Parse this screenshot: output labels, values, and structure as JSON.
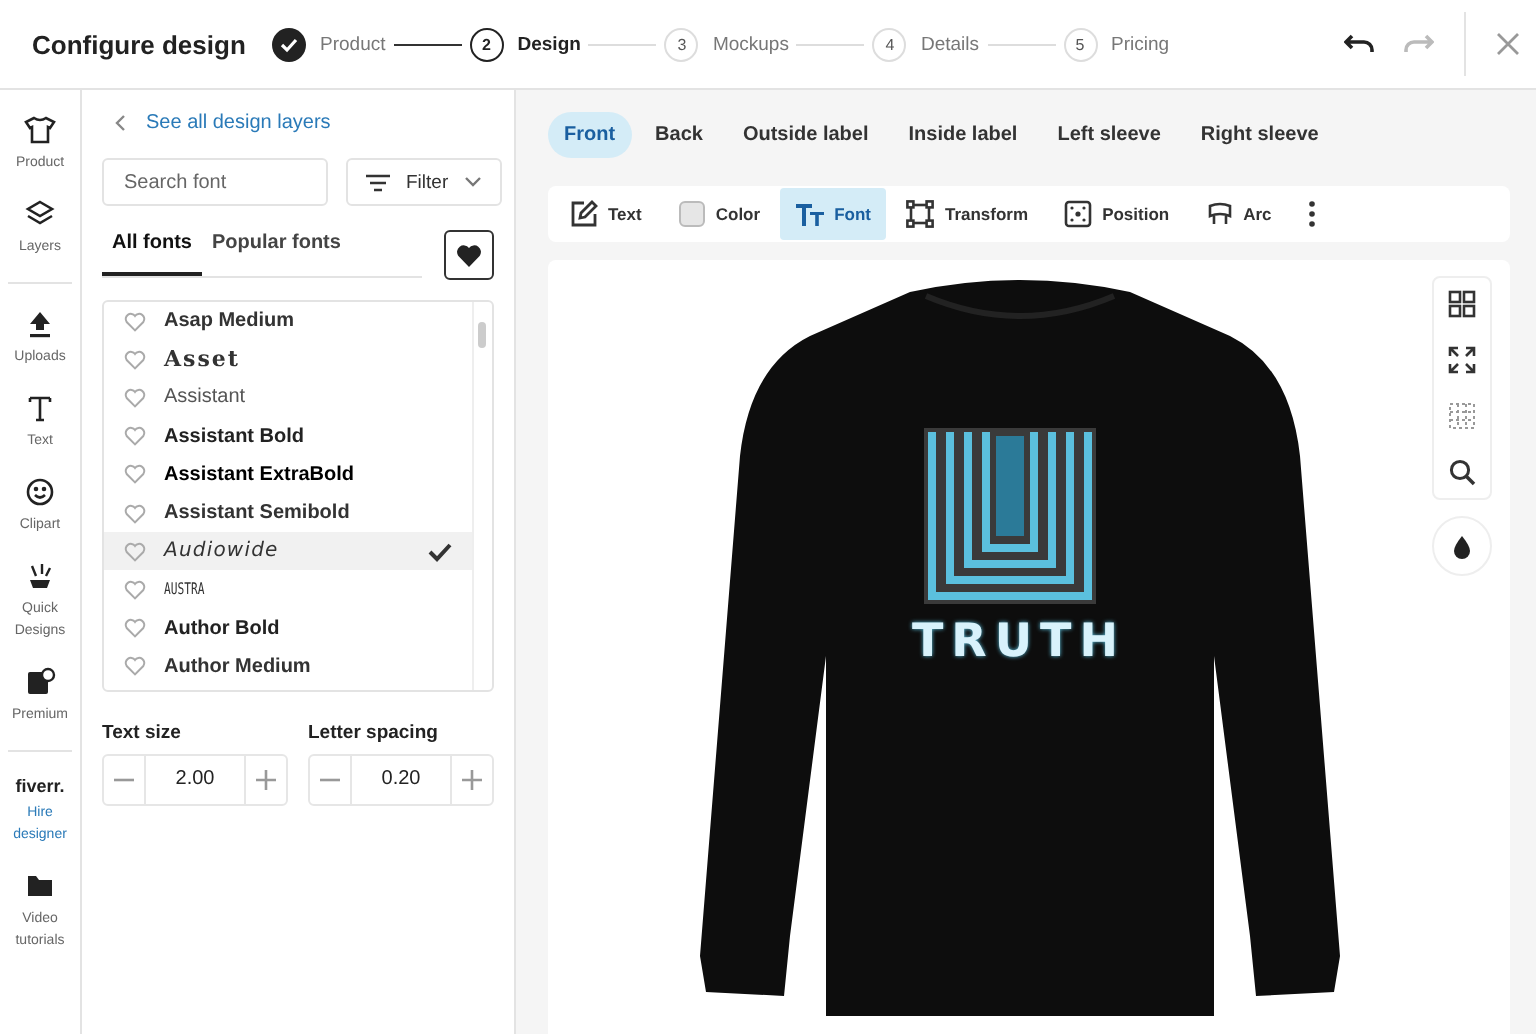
{
  "header": {
    "title": "Configure design",
    "steps": [
      {
        "label": "Product",
        "completed": true,
        "selected": false
      },
      {
        "number": "2",
        "label": "Design",
        "completed": false,
        "selected": true
      },
      {
        "number": "3",
        "label": "Mockups",
        "completed": false,
        "selected": false
      },
      {
        "number": "4",
        "label": "Details",
        "completed": false,
        "selected": false
      },
      {
        "number": "5",
        "label": "Pricing",
        "completed": false,
        "selected": false
      }
    ]
  },
  "rail": [
    {
      "kind": "tool",
      "label": "Product"
    },
    {
      "kind": "tool",
      "label": "Layers"
    },
    {
      "kind": "divider"
    },
    {
      "kind": "tool",
      "label": "Uploads"
    },
    {
      "kind": "tool",
      "label": "Text"
    },
    {
      "kind": "tool",
      "label": "Clipart"
    },
    {
      "kind": "tool",
      "label": "Quick Designs"
    },
    {
      "kind": "tool",
      "label": "Premium"
    },
    {
      "kind": "divider"
    },
    {
      "kind": "brand",
      "brand": "fiverr.",
      "label": "Hire designer"
    },
    {
      "kind": "tool",
      "label": "Video tutorials"
    }
  ],
  "panel": {
    "back_link": "See all design layers",
    "search": {
      "placeholder": "Search font"
    },
    "filter": "Filter",
    "tabs": [
      {
        "label": "All fonts",
        "selected": true
      },
      {
        "label": "Popular fonts",
        "selected": false
      }
    ],
    "fonts": [
      {
        "name": "Asap Medium",
        "kind": "medium",
        "selected": false
      },
      {
        "name": "Asset",
        "kind": "display",
        "selected": false
      },
      {
        "name": "Assistant",
        "kind": "light",
        "selected": false
      },
      {
        "name": "Assistant Bold",
        "kind": "bold",
        "selected": false
      },
      {
        "name": "Assistant ExtraBold",
        "kind": "extrabold",
        "selected": false
      },
      {
        "name": "Assistant Semibold",
        "kind": "medium",
        "selected": false
      },
      {
        "name": "Audiowide",
        "kind": "wide",
        "selected": true
      },
      {
        "name": "AUSTRA",
        "kind": "condensed",
        "selected": false
      },
      {
        "name": "Author Bold",
        "kind": "bold",
        "selected": false
      },
      {
        "name": "Author Medium",
        "kind": "medium",
        "selected": false
      }
    ],
    "text_size": {
      "label": "Text size",
      "value": "2.00"
    },
    "letter_spacing": {
      "label": "Letter spacing",
      "value": "0.20"
    }
  },
  "views": [
    {
      "label": "Front",
      "selected": true
    },
    {
      "label": "Back",
      "selected": false
    },
    {
      "label": "Outside label",
      "selected": false
    },
    {
      "label": "Inside label",
      "selected": false
    },
    {
      "label": "Left sleeve",
      "selected": false
    },
    {
      "label": "Right sleeve",
      "selected": false
    }
  ],
  "toolbar": [
    {
      "label": "Text",
      "selected": false
    },
    {
      "label": "Color",
      "selected": false
    },
    {
      "label": "Font",
      "selected": true
    },
    {
      "label": "Transform",
      "selected": false
    },
    {
      "label": "Position",
      "selected": false
    },
    {
      "label": "Arc",
      "selected": false
    }
  ],
  "canvas": {
    "design_text": "TRUTH"
  }
}
